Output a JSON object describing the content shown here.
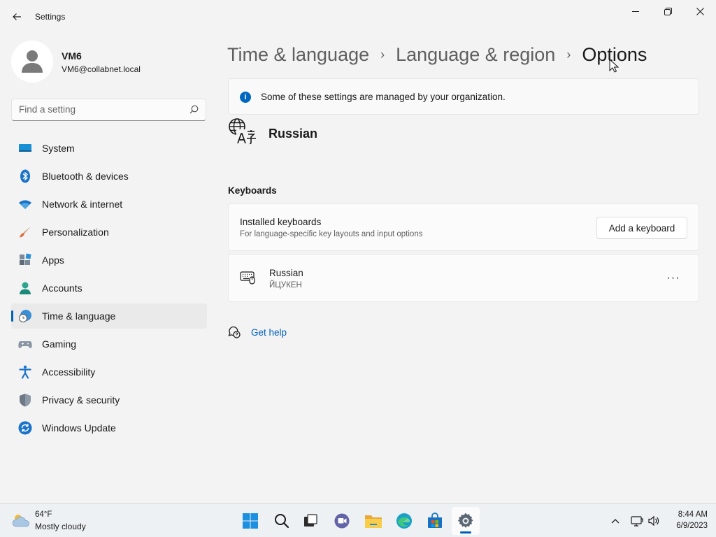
{
  "window": {
    "title": "Settings"
  },
  "user": {
    "name": "VM6",
    "email": "VM6@collabnet.local"
  },
  "search": {
    "placeholder": "Find a setting"
  },
  "sidebar": {
    "items": [
      {
        "label": "System",
        "icon": "system-icon"
      },
      {
        "label": "Bluetooth & devices",
        "icon": "bluetooth-icon"
      },
      {
        "label": "Network & internet",
        "icon": "wifi-icon"
      },
      {
        "label": "Personalization",
        "icon": "brush-icon"
      },
      {
        "label": "Apps",
        "icon": "apps-icon"
      },
      {
        "label": "Accounts",
        "icon": "person-icon"
      },
      {
        "label": "Time & language",
        "icon": "globe-clock-icon",
        "selected": true
      },
      {
        "label": "Gaming",
        "icon": "gamepad-icon"
      },
      {
        "label": "Accessibility",
        "icon": "accessibility-icon"
      },
      {
        "label": "Privacy & security",
        "icon": "shield-icon"
      },
      {
        "label": "Windows Update",
        "icon": "update-icon"
      }
    ]
  },
  "breadcrumb": {
    "items": [
      "Time & language",
      "Language & region",
      "Options"
    ]
  },
  "info_bar": {
    "text": "Some of these settings are managed by your organization."
  },
  "language": {
    "name": "Russian"
  },
  "keyboards": {
    "section_title": "Keyboards",
    "installed_title": "Installed keyboards",
    "installed_subtitle": "For language-specific key layouts and input options",
    "add_button": "Add a keyboard",
    "items": [
      {
        "name": "Russian",
        "layout": "ЙЦУКЕН"
      }
    ],
    "more_label": "···"
  },
  "help": {
    "link": "Get help"
  },
  "taskbar": {
    "weather_temp": "64°F",
    "weather_desc": "Mostly cloudy",
    "time": "8:44 AM",
    "date": "6/9/2023",
    "apps": [
      "start-icon",
      "search-icon",
      "task-view-icon",
      "chat-icon",
      "file-explorer-icon",
      "edge-icon",
      "store-icon",
      "settings-icon"
    ]
  },
  "colors": {
    "accent": "#005fb8",
    "background": "#f3f3f3"
  }
}
